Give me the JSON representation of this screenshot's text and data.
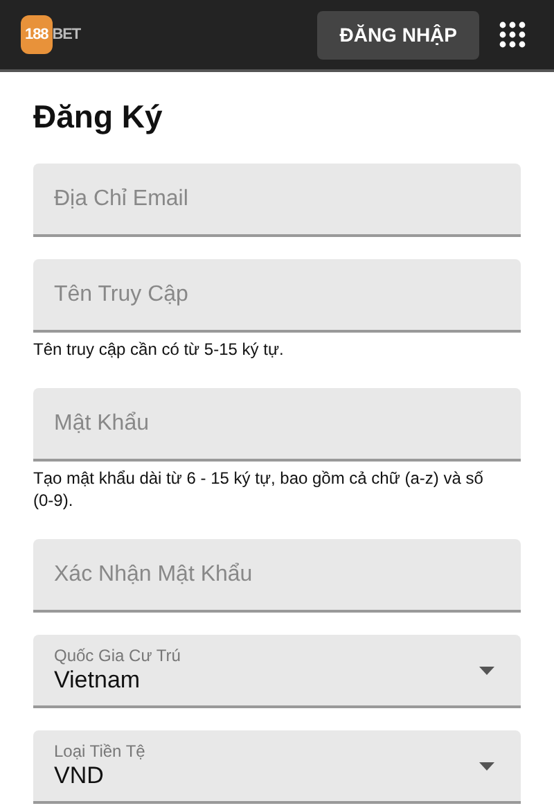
{
  "header": {
    "logo": {
      "number": "188",
      "word": "BET"
    },
    "login_button": "ĐĂNG NHẬP"
  },
  "title": "Đăng Ký",
  "fields": [
    {
      "kind": "text",
      "placeholder": "Địa Chỉ Email"
    },
    {
      "kind": "text",
      "placeholder": "Tên Truy Cập",
      "hint": "Tên truy cập cần có từ 5-15 ký tự."
    },
    {
      "kind": "text",
      "placeholder": "Mật Khẩu",
      "hint": "Tạo mật khẩu dài từ 6 - 15 ký tự, bao gồm cả chữ (a-z) và số (0-9)."
    },
    {
      "kind": "text",
      "placeholder": "Xác Nhận Mật Khẩu"
    },
    {
      "kind": "select",
      "label": "Quốc Gia Cư Trú",
      "value": "Vietnam"
    },
    {
      "kind": "select",
      "label": "Loại Tiền Tệ",
      "value": "VND"
    }
  ]
}
